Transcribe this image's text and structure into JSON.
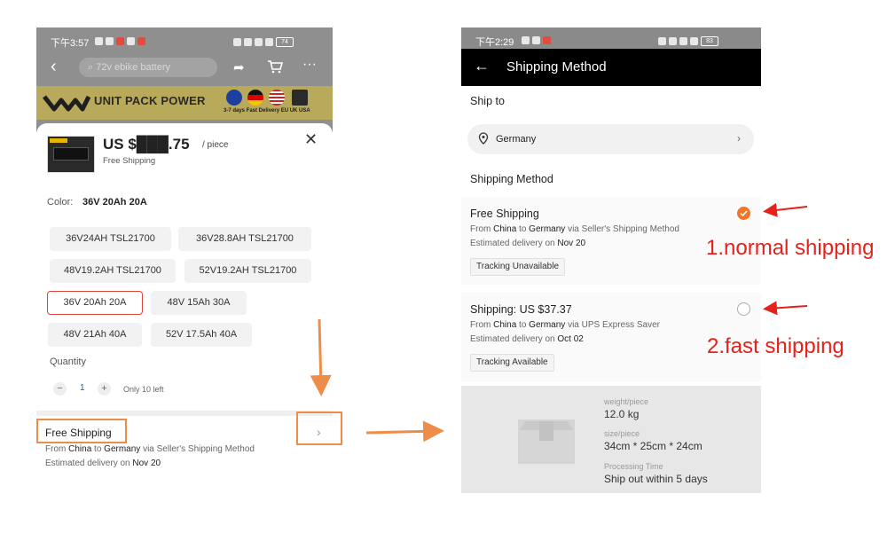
{
  "left": {
    "status_time": "下午3:57",
    "search_placeholder": "72v ebike battery",
    "banner_brand": "UNIT PACK POWER",
    "banner_tag": "3-7 days Fast Delivery EU UK USA",
    "battery": "74",
    "price": "US $███.75",
    "price_unit": "/ piece",
    "free_shipping_small": "Free Shipping",
    "color_label": "Color:",
    "color_value": "36V 20Ah 20A",
    "options": [
      "36V24AH TSL21700",
      "36V28.8AH TSL21700",
      "48V19.2AH TSL21700",
      "52V19.2AH TSL21700",
      "36V 20Ah 20A",
      "48V 15Ah 30A",
      "48V 21Ah 40A",
      "52V 17.5Ah 40A"
    ],
    "quantity_label": "Quantity",
    "quantity_value": "1",
    "stock_note": "Only 10 left",
    "shipping_title": "Free Shipping",
    "shipping_route": {
      "prefix": "From",
      "origin": "China",
      "mid": "to",
      "dest": "Germany",
      "suffix": "via Seller's Shipping Method"
    },
    "shipping_estimate": {
      "prefix": "Estimated delivery on",
      "date": "Nov 20"
    }
  },
  "right": {
    "status_time": "下午2:29",
    "battery": "83",
    "title": "Shipping Method",
    "ship_to_label": "Ship to",
    "country": "Germany",
    "shipping_method_label": "Shipping Method",
    "options": [
      {
        "title": "Free Shipping",
        "origin": "China",
        "dest": "Germany",
        "via": "via Seller's Shipping Method",
        "estimate_prefix": "Estimated delivery on",
        "estimate": "Nov 20",
        "tag": "Tracking Unavailable",
        "selected": true
      },
      {
        "title": "Shipping: US $37.37",
        "origin": "China",
        "dest": "Germany",
        "via": "via UPS Express Saver",
        "estimate_prefix": "Estimated delivery on",
        "estimate": "Oct 02",
        "tag": "Tracking Available",
        "selected": false
      }
    ],
    "from_word": "From",
    "to_word": "to",
    "weight_label": "weight/piece",
    "weight_value": "12.0 kg",
    "size_label": "size/piece",
    "size_value": "34cm * 25cm * 24cm",
    "processing_label": "Processing Time",
    "processing_value": "Ship out within 5 days"
  },
  "annotations": {
    "normal": "1.normal shipping",
    "fast": "2.fast shipping"
  },
  "colors": {
    "accent_orange": "#ee8c4a",
    "annotation_red": "#e5211b",
    "radio_selected": "#f0772a",
    "selected_chip_border": "#e0443a"
  }
}
